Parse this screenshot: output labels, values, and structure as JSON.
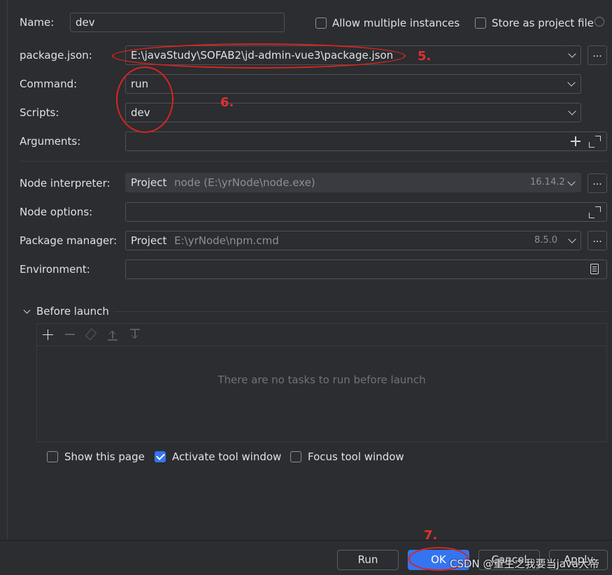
{
  "form": {
    "name_label": "Name:",
    "name_value": "dev",
    "allow_multiple_label": "Allow multiple instances",
    "store_project_label": "Store as project file",
    "package_json_label": "package.json:",
    "package_json_value": "E:\\javaStudy\\SOFAB2\\jd-admin-vue3\\package.json",
    "command_label": "Command:",
    "command_value": "run",
    "scripts_label": "Scripts:",
    "scripts_value": "dev",
    "arguments_label": "Arguments:",
    "node_interpreter_label": "Node interpreter:",
    "node_interpreter_prefix": "Project",
    "node_interpreter_path": "node (E:\\yrNode\\node.exe)",
    "node_version": "16.14.2",
    "node_options_label": "Node options:",
    "package_manager_label": "Package manager:",
    "package_manager_prefix": "Project",
    "package_manager_path": "E:\\yrNode\\npm.cmd",
    "package_manager_version": "8.5.0",
    "environment_label": "Environment:",
    "dots": "..."
  },
  "before_launch": {
    "title": "Before launch",
    "empty_text": "There are no tasks to run before launch"
  },
  "options": {
    "show_page": "Show this page",
    "show_page_checked": false,
    "activate_tool": "Activate tool window",
    "activate_tool_checked": true,
    "focus_tool": "Focus tool window",
    "focus_tool_checked": false
  },
  "buttons": {
    "run": "Run",
    "ok": "OK",
    "cancel": "Cancel",
    "apply": "Apply"
  },
  "annotations": {
    "step5": "5.",
    "step6": "6.",
    "step7": "7."
  },
  "watermark": "CSDN @重生之我要当java大帝",
  "colors": {
    "background": "#2b2d30",
    "accent": "#3574f0",
    "annotation_red": "#e0312f"
  }
}
